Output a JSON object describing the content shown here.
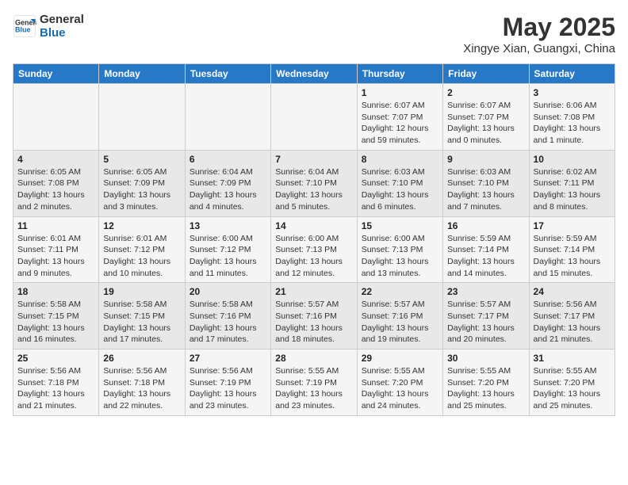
{
  "header": {
    "logo_line1": "General",
    "logo_line2": "Blue",
    "month_title": "May 2025",
    "location": "Xingye Xian, Guangxi, China"
  },
  "weekdays": [
    "Sunday",
    "Monday",
    "Tuesday",
    "Wednesday",
    "Thursday",
    "Friday",
    "Saturday"
  ],
  "weeks": [
    [
      {
        "day": "",
        "info": ""
      },
      {
        "day": "",
        "info": ""
      },
      {
        "day": "",
        "info": ""
      },
      {
        "day": "",
        "info": ""
      },
      {
        "day": "1",
        "info": "Sunrise: 6:07 AM\nSunset: 7:07 PM\nDaylight: 12 hours\nand 59 minutes."
      },
      {
        "day": "2",
        "info": "Sunrise: 6:07 AM\nSunset: 7:07 PM\nDaylight: 13 hours\nand 0 minutes."
      },
      {
        "day": "3",
        "info": "Sunrise: 6:06 AM\nSunset: 7:08 PM\nDaylight: 13 hours\nand 1 minute."
      }
    ],
    [
      {
        "day": "4",
        "info": "Sunrise: 6:05 AM\nSunset: 7:08 PM\nDaylight: 13 hours\nand 2 minutes."
      },
      {
        "day": "5",
        "info": "Sunrise: 6:05 AM\nSunset: 7:09 PM\nDaylight: 13 hours\nand 3 minutes."
      },
      {
        "day": "6",
        "info": "Sunrise: 6:04 AM\nSunset: 7:09 PM\nDaylight: 13 hours\nand 4 minutes."
      },
      {
        "day": "7",
        "info": "Sunrise: 6:04 AM\nSunset: 7:10 PM\nDaylight: 13 hours\nand 5 minutes."
      },
      {
        "day": "8",
        "info": "Sunrise: 6:03 AM\nSunset: 7:10 PM\nDaylight: 13 hours\nand 6 minutes."
      },
      {
        "day": "9",
        "info": "Sunrise: 6:03 AM\nSunset: 7:10 PM\nDaylight: 13 hours\nand 7 minutes."
      },
      {
        "day": "10",
        "info": "Sunrise: 6:02 AM\nSunset: 7:11 PM\nDaylight: 13 hours\nand 8 minutes."
      }
    ],
    [
      {
        "day": "11",
        "info": "Sunrise: 6:01 AM\nSunset: 7:11 PM\nDaylight: 13 hours\nand 9 minutes."
      },
      {
        "day": "12",
        "info": "Sunrise: 6:01 AM\nSunset: 7:12 PM\nDaylight: 13 hours\nand 10 minutes."
      },
      {
        "day": "13",
        "info": "Sunrise: 6:00 AM\nSunset: 7:12 PM\nDaylight: 13 hours\nand 11 minutes."
      },
      {
        "day": "14",
        "info": "Sunrise: 6:00 AM\nSunset: 7:13 PM\nDaylight: 13 hours\nand 12 minutes."
      },
      {
        "day": "15",
        "info": "Sunrise: 6:00 AM\nSunset: 7:13 PM\nDaylight: 13 hours\nand 13 minutes."
      },
      {
        "day": "16",
        "info": "Sunrise: 5:59 AM\nSunset: 7:14 PM\nDaylight: 13 hours\nand 14 minutes."
      },
      {
        "day": "17",
        "info": "Sunrise: 5:59 AM\nSunset: 7:14 PM\nDaylight: 13 hours\nand 15 minutes."
      }
    ],
    [
      {
        "day": "18",
        "info": "Sunrise: 5:58 AM\nSunset: 7:15 PM\nDaylight: 13 hours\nand 16 minutes."
      },
      {
        "day": "19",
        "info": "Sunrise: 5:58 AM\nSunset: 7:15 PM\nDaylight: 13 hours\nand 17 minutes."
      },
      {
        "day": "20",
        "info": "Sunrise: 5:58 AM\nSunset: 7:16 PM\nDaylight: 13 hours\nand 17 minutes."
      },
      {
        "day": "21",
        "info": "Sunrise: 5:57 AM\nSunset: 7:16 PM\nDaylight: 13 hours\nand 18 minutes."
      },
      {
        "day": "22",
        "info": "Sunrise: 5:57 AM\nSunset: 7:16 PM\nDaylight: 13 hours\nand 19 minutes."
      },
      {
        "day": "23",
        "info": "Sunrise: 5:57 AM\nSunset: 7:17 PM\nDaylight: 13 hours\nand 20 minutes."
      },
      {
        "day": "24",
        "info": "Sunrise: 5:56 AM\nSunset: 7:17 PM\nDaylight: 13 hours\nand 21 minutes."
      }
    ],
    [
      {
        "day": "25",
        "info": "Sunrise: 5:56 AM\nSunset: 7:18 PM\nDaylight: 13 hours\nand 21 minutes."
      },
      {
        "day": "26",
        "info": "Sunrise: 5:56 AM\nSunset: 7:18 PM\nDaylight: 13 hours\nand 22 minutes."
      },
      {
        "day": "27",
        "info": "Sunrise: 5:56 AM\nSunset: 7:19 PM\nDaylight: 13 hours\nand 23 minutes."
      },
      {
        "day": "28",
        "info": "Sunrise: 5:55 AM\nSunset: 7:19 PM\nDaylight: 13 hours\nand 23 minutes."
      },
      {
        "day": "29",
        "info": "Sunrise: 5:55 AM\nSunset: 7:20 PM\nDaylight: 13 hours\nand 24 minutes."
      },
      {
        "day": "30",
        "info": "Sunrise: 5:55 AM\nSunset: 7:20 PM\nDaylight: 13 hours\nand 25 minutes."
      },
      {
        "day": "31",
        "info": "Sunrise: 5:55 AM\nSunset: 7:20 PM\nDaylight: 13 hours\nand 25 minutes."
      }
    ]
  ]
}
